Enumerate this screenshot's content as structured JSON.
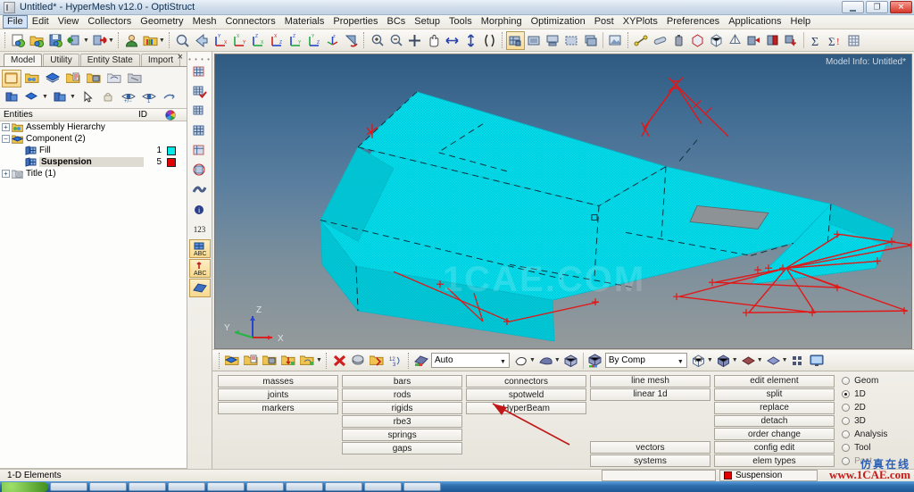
{
  "window": {
    "title": "Untitled* - HyperMesh v12.0 - OptiStruct",
    "minimize_label": "0",
    "maximize_label": "❐",
    "close_label": "✕"
  },
  "menu": {
    "items": [
      {
        "label": "File",
        "active": true
      },
      {
        "label": "Edit"
      },
      {
        "label": "View"
      },
      {
        "label": "Collectors"
      },
      {
        "label": "Geometry"
      },
      {
        "label": "Mesh"
      },
      {
        "label": "Connectors"
      },
      {
        "label": "Materials"
      },
      {
        "label": "Properties"
      },
      {
        "label": "BCs"
      },
      {
        "label": "Setup"
      },
      {
        "label": "Tools"
      },
      {
        "label": "Morphing"
      },
      {
        "label": "Optimization"
      },
      {
        "label": "Post"
      },
      {
        "label": "XYPlots"
      },
      {
        "label": "Preferences"
      },
      {
        "label": "Applications"
      },
      {
        "label": "Help"
      }
    ]
  },
  "toolbar": {
    "groups": [
      {
        "name": "file",
        "icons": [
          "new-file-icon",
          "open-file-icon",
          "save-file-icon",
          "import-icon",
          "export-icon"
        ]
      },
      {
        "name": "session",
        "icons": [
          "user-profile-icon",
          "load-results-icon"
        ]
      },
      {
        "name": "view",
        "icons": [
          "zoom-fit-icon",
          "previous-view-icon",
          "xy-view-icon",
          "yx-view-icon",
          "zx-view-icon",
          "xz-view-icon",
          "zy-view-icon",
          "yz-view-icon",
          "iso-view-icon",
          "rotate-icon"
        ]
      },
      {
        "name": "navigate",
        "icons": [
          "zoom-in-icon",
          "zoom-out-icon",
          "fit-icon",
          "pan-icon",
          "arrow-left-right-icon",
          "arrow-up-down-icon",
          "circle-arc-icon"
        ]
      },
      {
        "name": "visualization",
        "icons": [
          "wireframe-icon",
          "shaded-icon",
          "shaded-edges-icon",
          "hidden-line-icon",
          "feature-lines-icon",
          "render-icon"
        ]
      },
      {
        "name": "checks",
        "icons": [
          "distance-icon",
          "measure-icon",
          "mass-calc-icon",
          "box-trim-icon",
          "geom-check-icon",
          "tetra-mesh-icon",
          "solid-icon",
          "normals-icon",
          "free-edges-icon",
          "dup-elems-icon",
          "sum-icon",
          "sum-alert-icon",
          "matrix-browser-icon"
        ]
      }
    ]
  },
  "left_panel": {
    "tabs": [
      {
        "label": "Model",
        "active": true
      },
      {
        "label": "Utility",
        "active": false
      },
      {
        "label": "Entity State",
        "active": false
      },
      {
        "label": "Import",
        "active": false
      }
    ],
    "close_label": "×",
    "icon_row_1": [
      "new-collector-icon",
      "organize-icon",
      "components-icon",
      "card-editor-icon",
      "delete-entity-icon",
      "renumber-icon",
      "mask-icon"
    ],
    "icon_row_2": [
      "isolate-icon",
      "shaded-dropdown-icon",
      "component-dropdown-icon",
      "select-pointer-icon",
      "lock-icon",
      "show-hide-icon",
      "show-only-icon",
      "reverse-icon"
    ],
    "tree_header": {
      "entities": "Entities",
      "id": "ID",
      "color": "color-wheel-icon"
    },
    "tree": [
      {
        "label": "Assembly Hierarchy",
        "level": 1,
        "expander": "+",
        "icon": "assembly-icon",
        "id": "",
        "color": "",
        "bold": false
      },
      {
        "label": "Component (2)",
        "level": 1,
        "expander": "-",
        "icon": "component-folder-icon",
        "id": "",
        "color": "",
        "bold": false
      },
      {
        "label": "Fill",
        "level": 2,
        "expander": "",
        "icon": "component-icon",
        "id": "1",
        "color": "#00e8e8",
        "bold": false
      },
      {
        "label": "Suspension",
        "level": 2,
        "expander": "",
        "icon": "component-icon",
        "id": "5",
        "color": "#e00000",
        "bold": true
      },
      {
        "label": "Title (1)",
        "level": 1,
        "expander": "+",
        "icon": "title-icon",
        "id": "",
        "color": "",
        "bold": false
      }
    ]
  },
  "vertical_strip": {
    "grip": "• • • •",
    "icons": [
      {
        "name": "mesh-display-icon",
        "selected": false
      },
      {
        "name": "mesh-check-icon",
        "selected": false
      },
      {
        "name": "mesh-edit-icon",
        "selected": false
      },
      {
        "name": "mesh-grid-icon",
        "selected": false
      },
      {
        "name": "mesh-frame-icon",
        "selected": false
      },
      {
        "name": "mesh-circle-icon",
        "selected": false
      },
      {
        "name": "ribbon-icon",
        "selected": false
      },
      {
        "name": "info-icon",
        "selected": false
      },
      {
        "name": "numbers-123-icon",
        "selected": false
      },
      {
        "name": "abc-grid-icon",
        "selected": true
      },
      {
        "name": "abc-vector-icon",
        "selected": true
      },
      {
        "name": "plane-icon",
        "selected": true
      }
    ]
  },
  "viewport": {
    "model_info": "Model Info: Untitled*",
    "watermark": "1CAE.COM",
    "axis_triad": {
      "x": "X",
      "y": "Y",
      "z": "Z"
    },
    "mesh_color": "#00e8f0",
    "rigids_color": "#e21717",
    "background_top": "#2f5b82",
    "background_bottom": "#949a9b"
  },
  "viewport_toolbar": {
    "icons_left": [
      "collector-icon",
      "card-icon",
      "delete-collector-icon",
      "reorder-icon",
      "organize-icon",
      "dropdown-icon"
    ],
    "icons_mid": [
      "delete-icon",
      "copy-icon",
      "merge-icon",
      "renumber-icon"
    ],
    "mode_select": {
      "value": "Auto",
      "name": "selection-mode-dropdown"
    },
    "shape_icons": [
      "circle-select-icon",
      "polygon-select-icon",
      "box-select-icon"
    ],
    "color_select": {
      "value": "By Comp",
      "name": "color-mode-dropdown"
    },
    "display_icons": [
      "wireframe-cube-icon",
      "shaded-cube-icon",
      "surface-icon",
      "solid-icon",
      "elements-icon",
      "screen-icon"
    ]
  },
  "command_panel": {
    "columns": [
      {
        "buttons": [
          "masses",
          "joints",
          "markers"
        ]
      },
      {
        "buttons": [
          "bars",
          "rods",
          "rigids",
          "rbe3",
          "springs",
          "gaps"
        ]
      },
      {
        "buttons": [
          "connectors",
          "spotweld",
          "HyperBeam"
        ]
      },
      {
        "buttons": [
          "line mesh",
          "linear 1d",
          "",
          "",
          "",
          "vectors",
          "systems"
        ]
      },
      {
        "buttons": [
          "edit element",
          "split",
          "replace",
          "detach",
          "order change",
          "config edit",
          "elem types"
        ]
      }
    ],
    "radios": [
      {
        "label": "Geom",
        "selected": false,
        "dim": false
      },
      {
        "label": "1D",
        "selected": true,
        "dim": false
      },
      {
        "label": "2D",
        "selected": false,
        "dim": false
      },
      {
        "label": "3D",
        "selected": false,
        "dim": false
      },
      {
        "label": "Analysis",
        "selected": false,
        "dim": false
      },
      {
        "label": "Tool",
        "selected": false,
        "dim": false
      },
      {
        "label": "Post",
        "selected": false,
        "dim": true
      }
    ]
  },
  "status_bar": {
    "message": "1-D Elements",
    "input_value": "",
    "component": "Suspension",
    "component_color": "#e00000"
  },
  "watermark_footer": {
    "chinese": "仿真在线",
    "url": "www.1CAE.com"
  }
}
